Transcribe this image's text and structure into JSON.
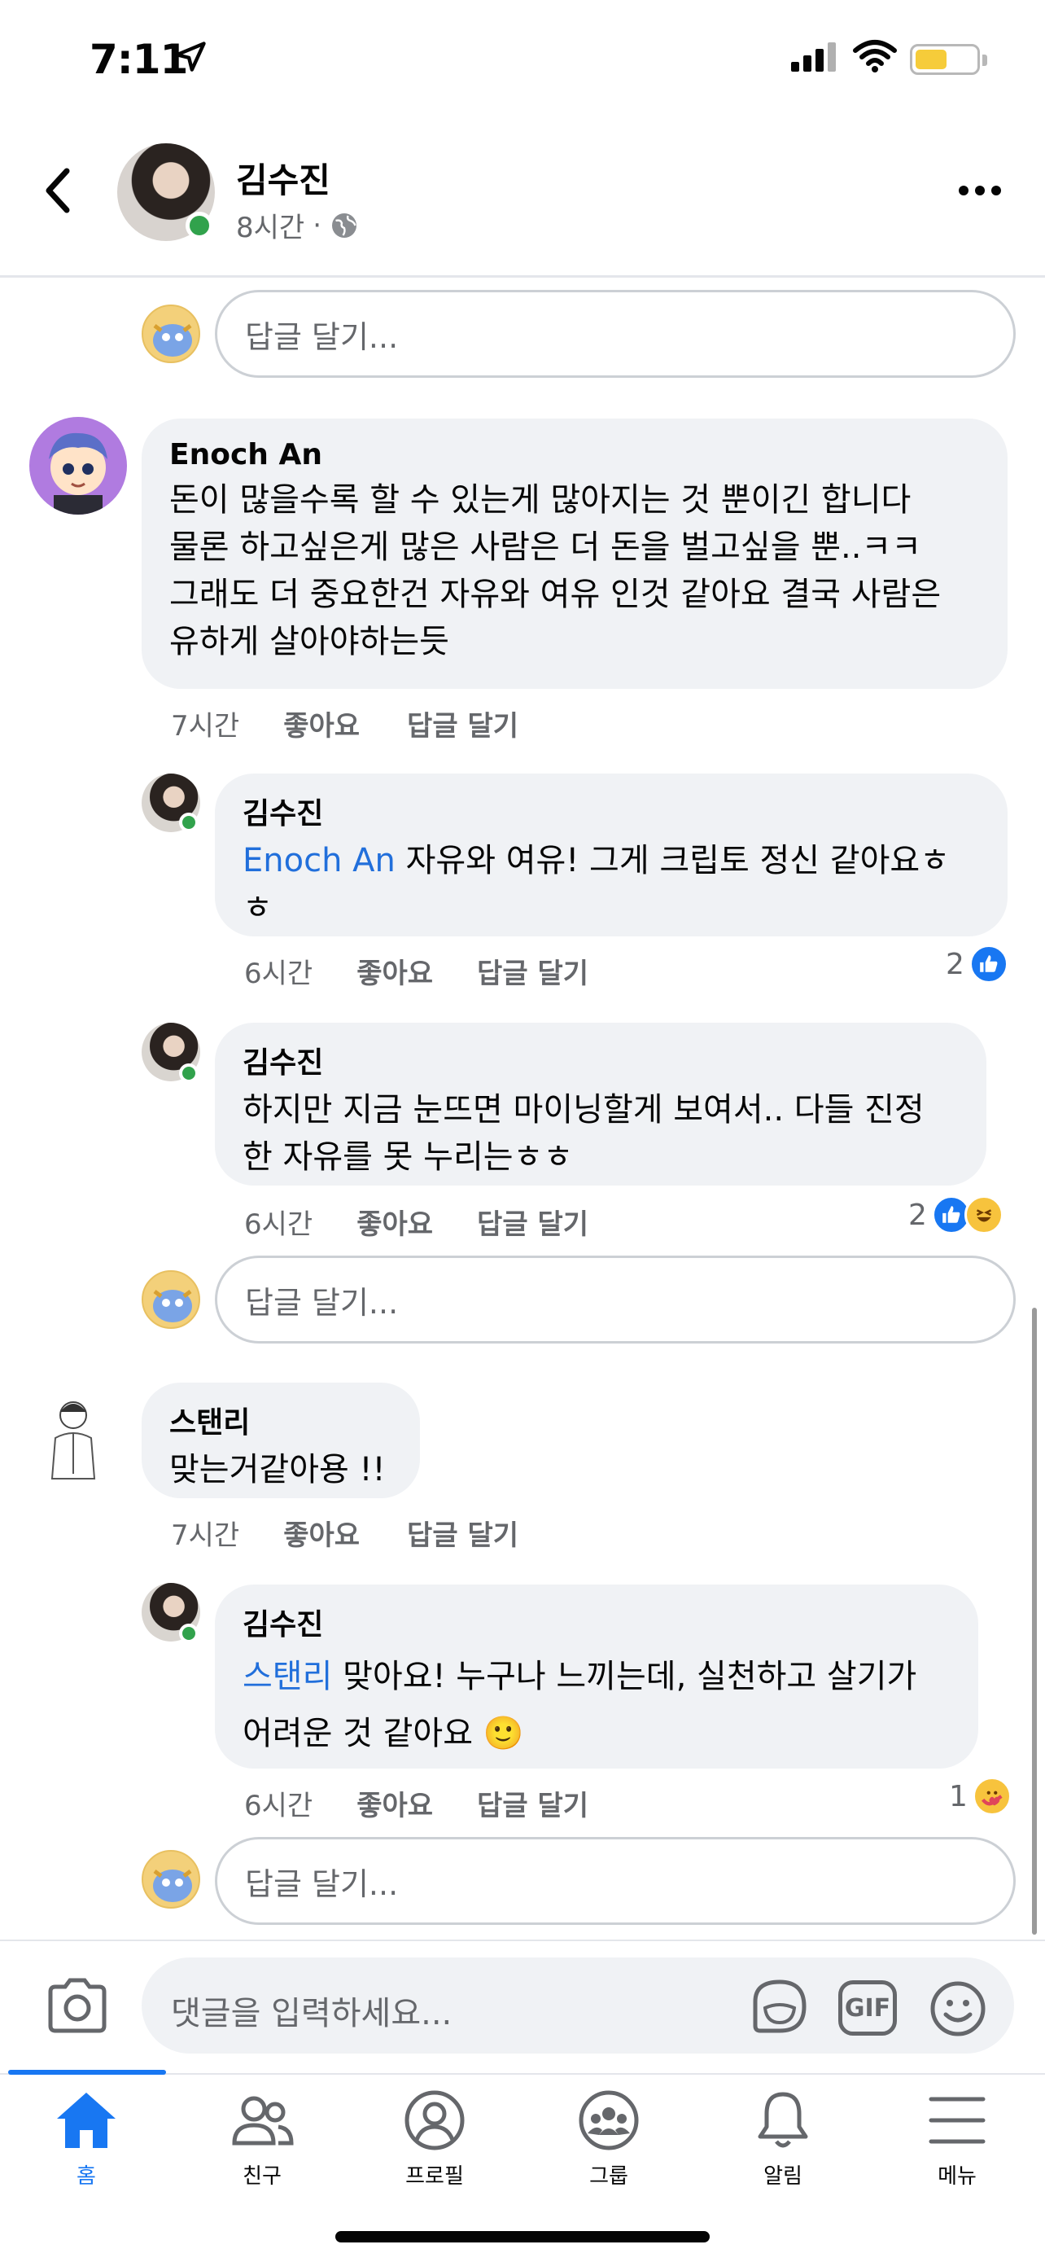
{
  "status_bar": {
    "time": "7:11"
  },
  "header": {
    "name": "김수진",
    "time": "8시간",
    "separator": "·"
  },
  "comments": {
    "reply_placeholder": "답글 달기...",
    "c1": {
      "author": "Enoch An",
      "text": "돈이 많을수록 할 수 있는게 많아지는 것 뿐이긴 합니다\n물론 하고싶은게 많은 사람은 더 돈을 벌고싶을 뿐..ㅋㅋ\n그래도 더 중요한건 자유와 여유 인것 같아요 결국 사람은\n유하게 살아야하는듯",
      "time": "7시간",
      "like": "좋아요",
      "reply": "답글 달기"
    },
    "r1": {
      "author": "김수진",
      "mention": "Enoch An",
      "text": " 자유와 여유! 그게 크립토 정신 같아요ㅎ\nㅎ",
      "time": "6시간",
      "like": "좋아요",
      "reply": "답글 달기",
      "reaction_count": "2"
    },
    "r2": {
      "author": "김수진",
      "text": "하지만 지금 눈뜨면 마이닝할게 보여서.. 다들 진정\n한 자유를 못 누리는ㅎㅎ",
      "time": "6시간",
      "like": "좋아요",
      "reply": "답글 달기",
      "reaction_count": "2"
    },
    "c2": {
      "author": "스탠리",
      "text": "맞는거같아용 !!",
      "time": "7시간",
      "like": "좋아요",
      "reply": "답글 달기"
    },
    "r3": {
      "author": "김수진",
      "mention": "스탠리",
      "text": " 맞아요! 누구나 느끼는데, 실천하고 살기가\n어려운 것 같아요 🙂",
      "time": "6시간",
      "like": "좋아요",
      "reply": "답글 달기",
      "reaction_count": "1"
    }
  },
  "composer": {
    "placeholder": "댓글을 입력하세요...",
    "gif_label": "GIF"
  },
  "tabs": [
    {
      "label": "홈",
      "icon": "home-icon",
      "active": true
    },
    {
      "label": "친구",
      "icon": "friends-icon"
    },
    {
      "label": "프로필",
      "icon": "profile-icon"
    },
    {
      "label": "그룹",
      "icon": "groups-icon"
    },
    {
      "label": "알림",
      "icon": "bell-icon"
    },
    {
      "label": "메뉴",
      "icon": "menu-icon"
    }
  ],
  "colors": {
    "accent": "#1877f2",
    "mention": "#216fdb",
    "bubble": "#f0f2f5",
    "online": "#31a24c"
  }
}
